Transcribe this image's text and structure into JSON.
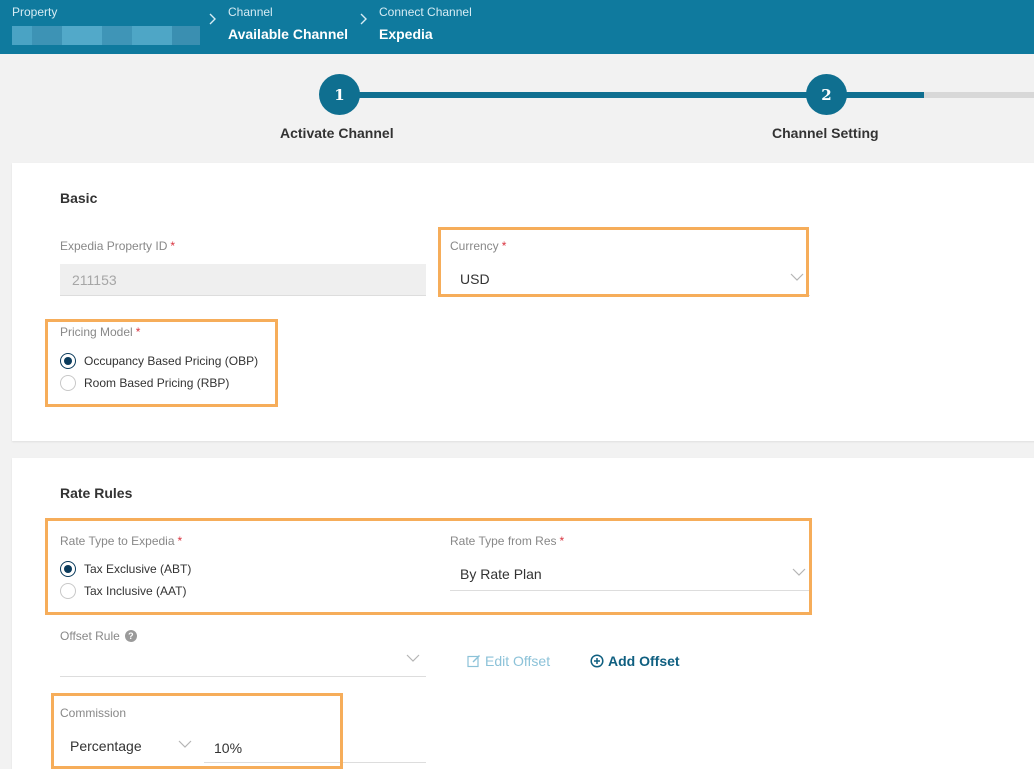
{
  "breadcrumb": [
    {
      "key": "Property",
      "value": ""
    },
    {
      "key": "Channel",
      "value": "Available Channel"
    },
    {
      "key": "Connect Channel",
      "value": "Expedia"
    }
  ],
  "steps": [
    {
      "number": "1",
      "label": "Activate Channel"
    },
    {
      "number": "2",
      "label": "Channel Setting"
    }
  ],
  "basic": {
    "title": "Basic",
    "property_id_label": "Expedia Property ID",
    "property_id_value": "211153",
    "currency_label": "Currency",
    "currency_value": "USD",
    "pricing_model_label": "Pricing Model",
    "pricing_options": [
      "Occupancy Based Pricing (OBP)",
      "Room Based Pricing (RBP)"
    ],
    "pricing_selected": "Occupancy Based Pricing (OBP)"
  },
  "rate_rules": {
    "title": "Rate Rules",
    "rate_type_to_label": "Rate Type to Expedia",
    "rate_type_to_options": [
      "Tax Exclusive (ABT)",
      "Tax Inclusive (AAT)"
    ],
    "rate_type_to_selected": "Tax Exclusive (ABT)",
    "rate_type_from_label": "Rate Type from Res",
    "rate_type_from_value": "By Rate Plan",
    "offset_rule_label": "Offset Rule",
    "offset_rule_help": "?",
    "offset_rule_value": "",
    "edit_offset_label": "Edit Offset",
    "add_offset_label": "Add Offset",
    "commission_label": "Commission",
    "commission_type_value": "Percentage",
    "commission_value": "10%"
  },
  "colors": {
    "header": "#0f7a9e",
    "step": "#0f6f90",
    "highlight": "#f6ad5a",
    "required": "#d9333f"
  }
}
